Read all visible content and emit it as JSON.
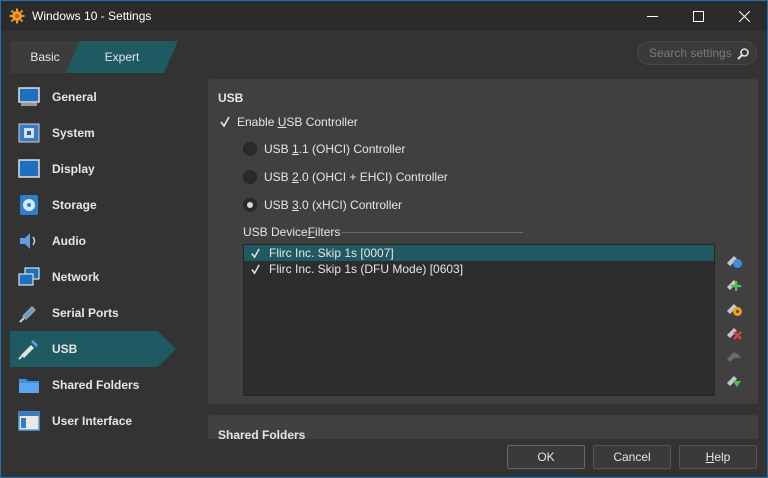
{
  "window": {
    "title": "Windows 10 - Settings",
    "accent": "#1f5a62"
  },
  "mode": {
    "basic": "Basic",
    "expert": "Expert"
  },
  "search": {
    "placeholder": "Search settings"
  },
  "sidebar": {
    "items": [
      {
        "label": "General",
        "icon": "monitor-general-icon"
      },
      {
        "label": "System",
        "icon": "chip-icon"
      },
      {
        "label": "Display",
        "icon": "display-icon"
      },
      {
        "label": "Storage",
        "icon": "disk-icon"
      },
      {
        "label": "Audio",
        "icon": "speaker-icon"
      },
      {
        "label": "Network",
        "icon": "network-icon"
      },
      {
        "label": "Serial Ports",
        "icon": "serial-port-icon"
      },
      {
        "label": "USB",
        "icon": "usb-icon",
        "active": true
      },
      {
        "label": "Shared Folders",
        "icon": "folder-icon"
      },
      {
        "label": "User Interface",
        "icon": "window-icon"
      }
    ]
  },
  "usb": {
    "section_title": "USB",
    "enable_pre": "Enable ",
    "enable_u": "U",
    "enable_post": "SB Controller",
    "enable_checked": true,
    "radios": [
      {
        "pre": "USB ",
        "u": "1",
        "post": ".1 (OHCI) Controller",
        "selected": false
      },
      {
        "pre": "USB ",
        "u": "2",
        "post": ".0 (OHCI + EHCI) Controller",
        "selected": false
      },
      {
        "pre": "USB ",
        "u": "3",
        "post": ".0 (xHCI) Controller",
        "selected": true
      }
    ],
    "filters_pre": "USB Device ",
    "filters_u": "F",
    "filters_post": "ilters",
    "filters": [
      {
        "label": "Flirc Inc. Skip 1s [0007]",
        "checked": true,
        "selected": true
      },
      {
        "label": "Flirc Inc. Skip 1s (DFU Mode) [0603]",
        "checked": true,
        "selected": false
      }
    ],
    "tools": [
      {
        "icon": "add-empty-filter-icon"
      },
      {
        "icon": "add-filter-from-device-icon"
      },
      {
        "icon": "edit-filter-icon"
      },
      {
        "icon": "remove-filter-icon"
      },
      {
        "icon": "move-filter-up-icon"
      },
      {
        "icon": "move-filter-down-icon"
      }
    ]
  },
  "shared": {
    "section_title": "Shared Folders"
  },
  "footer": {
    "ok": "OK",
    "cancel": "Cancel",
    "help_u": "H",
    "help_post": "elp"
  }
}
